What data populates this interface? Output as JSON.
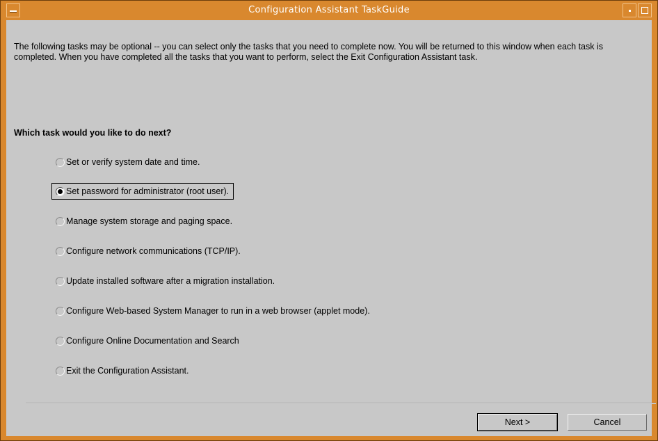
{
  "window": {
    "title": "Configuration Assistant TaskGuide",
    "accent_color": "#d9882e",
    "menu_icon": "window-menu-icon",
    "minimize_icon": "minimize-icon",
    "maximize_icon": "maximize-icon"
  },
  "intro": {
    "text": "The following tasks may be optional -- you can select only the tasks that you need to complete now. You will be returned to this window when each task is completed.  When you have completed all the tasks that you want to perform, select the Exit Configuration Assistant task."
  },
  "question": "Which task would you like to do next?",
  "options": [
    {
      "label": "Set or verify system date and time.",
      "selected": false
    },
    {
      "label": "Set password for administrator (root user).",
      "selected": true
    },
    {
      "label": "Manage system storage and paging space.",
      "selected": false
    },
    {
      "label": "Configure network communications (TCP/IP).",
      "selected": false
    },
    {
      "label": "Update installed software after a migration installation.",
      "selected": false
    },
    {
      "label": "Configure Web-based System Manager to run in a web browser (applet mode).",
      "selected": false
    },
    {
      "label": "Configure Online Documentation and Search",
      "selected": false
    },
    {
      "label": "Exit the Configuration Assistant.",
      "selected": false
    }
  ],
  "buttons": {
    "next": "Next >",
    "cancel": "Cancel"
  }
}
